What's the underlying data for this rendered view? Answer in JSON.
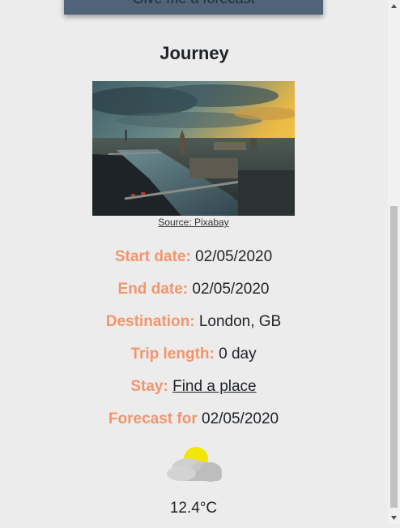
{
  "top_button": {
    "label": "Give me a forecast"
  },
  "journey": {
    "title": "Journey",
    "photo_source_label": "Source: Pixabay",
    "start_date": {
      "label": "Start date:",
      "value": "02/05/2020"
    },
    "end_date": {
      "label": "End date:",
      "value": "02/05/2020"
    },
    "destination": {
      "label": "Destination:",
      "value": "London, GB"
    },
    "trip_length": {
      "label": "Trip length:",
      "value": "0 day"
    },
    "stay": {
      "label": "Stay:",
      "link": "Find a place"
    },
    "forecast": {
      "label": "Forecast for",
      "value": "02/05/2020"
    },
    "weather_icon": "partly-cloudy-icon",
    "temperature": "12.4°C"
  },
  "colors": {
    "label_accent": "#f3956c",
    "button_bg": "#4f6478",
    "page_bg": "#ececec"
  }
}
